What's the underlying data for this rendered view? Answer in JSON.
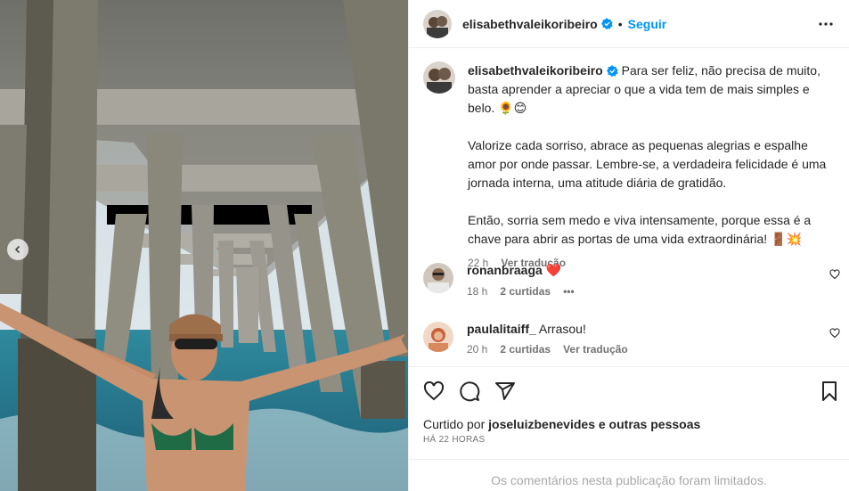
{
  "post": {
    "username": "elisabethvaleikoribeiro",
    "follow_label": "Seguir",
    "separator": "•"
  },
  "caption": {
    "line1": "Para ser feliz, não precisa de muito, basta aprender a apreciar o que a vida tem de mais simples e belo. 🌻😊",
    "para2": "Valorize cada sorriso, abrace as pequenas alegrias e espalhe amor por onde passar. Lembre-se, a verdadeira felicidade é uma jornada interna, uma atitude diária de gratidão.",
    "para3": "Então, sorria sem medo e viva intensamente, porque essa é a chave para abrir as portas de uma vida extraordinária! 🚪💥",
    "time": "22 h",
    "translate": "Ver tradução"
  },
  "comments": [
    {
      "username": "ronanbraaga",
      "text": "❤️",
      "time": "18 h",
      "likes": "2 curtidas",
      "more": "•••"
    },
    {
      "username": "paulalitaiff_",
      "text": "Arrasou!",
      "time": "20 h",
      "likes": "2 curtidas",
      "translate": "Ver tradução"
    }
  ],
  "likes_line": {
    "prefix": "Curtido por ",
    "user": "joseluizbenevides",
    "suffix": " e outras pessoas"
  },
  "timeago": "HÁ 22 HORAS",
  "limited_notice": "Os comentários nesta publicação foram limitados.",
  "icons": {
    "verified": "verified-badge-icon",
    "more": "more-options-icon",
    "like": "heart-icon",
    "comment": "comment-icon",
    "share": "share-icon",
    "save": "bookmark-icon",
    "prev": "chevron-left-icon"
  },
  "colors": {
    "accent": "#0095f6",
    "verified": "#0095f6",
    "text": "#262626",
    "muted": "#737373"
  }
}
